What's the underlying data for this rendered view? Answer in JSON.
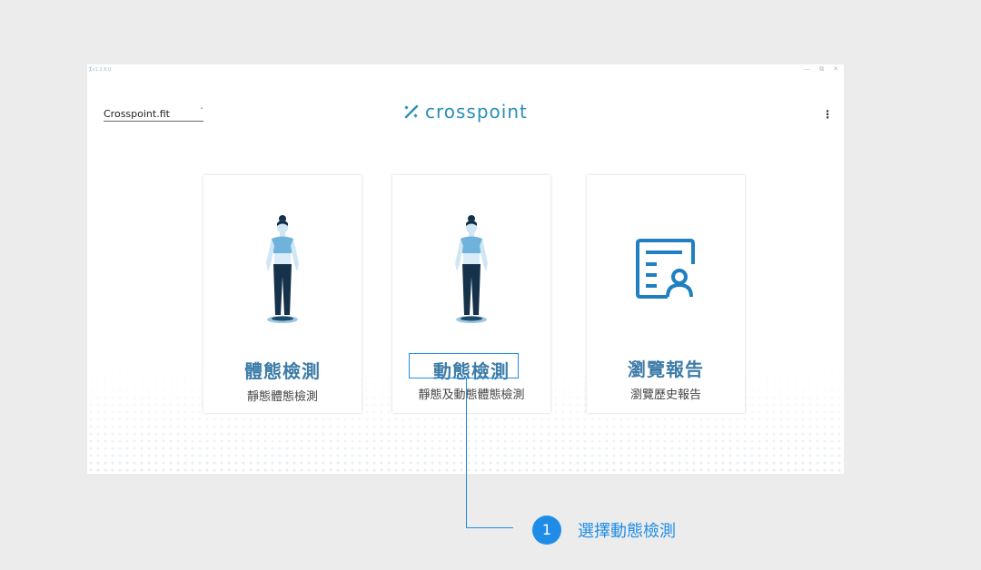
{
  "window": {
    "version": "v1.2.6.0",
    "controls": [
      "—",
      "⧉",
      "✕"
    ]
  },
  "header": {
    "account_name": "Crosspoint.fit",
    "logo_text": "crosspoint",
    "more_icon": "⋮"
  },
  "cards": [
    {
      "title": "體態檢測",
      "subtitle": "靜態體態檢測",
      "icon": "figure-female"
    },
    {
      "title": "動態檢測",
      "subtitle": "靜態及動態體態檢測",
      "icon": "figure-female-dark-pants"
    },
    {
      "title": "瀏覽報告",
      "subtitle": "瀏覽歷史報告",
      "icon": "report-user-icon"
    }
  ],
  "annotation": {
    "step_number": "1",
    "step_text": "選擇動態檢測"
  },
  "colors": {
    "accent": "#1f8de8",
    "card_title": "#3d7ca8",
    "logo": "#2a8fb8"
  }
}
